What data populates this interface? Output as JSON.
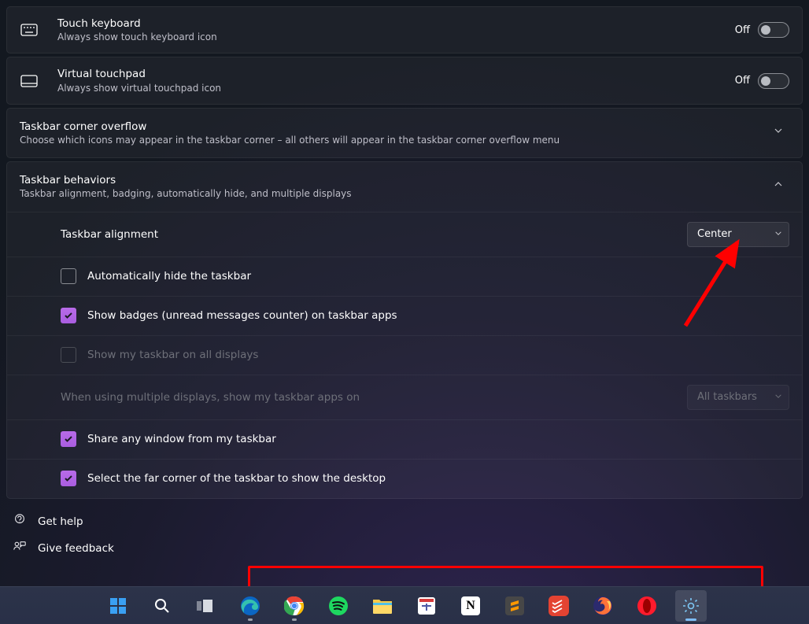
{
  "items": {
    "touch_keyboard": {
      "title": "Touch keyboard",
      "sub": "Always show touch keyboard icon",
      "state": "Off"
    },
    "virtual_touchpad": {
      "title": "Virtual touchpad",
      "sub": "Always show virtual touchpad icon",
      "state": "Off"
    }
  },
  "sections": {
    "overflow": {
      "title": "Taskbar corner overflow",
      "sub": "Choose which icons may appear in the taskbar corner – all others will appear in the taskbar corner overflow menu"
    },
    "behaviors": {
      "title": "Taskbar behaviors",
      "sub": "Taskbar alignment, badging, automatically hide, and multiple displays"
    }
  },
  "behaviors": {
    "alignment": {
      "label": "Taskbar alignment",
      "value": "Center"
    },
    "auto_hide": {
      "label": "Automatically hide the taskbar",
      "checked": false
    },
    "badges": {
      "label": "Show badges (unread messages counter) on taskbar apps",
      "checked": true
    },
    "all_displays": {
      "label": "Show my taskbar on all displays",
      "checked": false
    },
    "multi_label": "When using multiple displays, show my taskbar apps on",
    "multi_value": "All taskbars",
    "share_window": {
      "label": "Share any window from my taskbar",
      "checked": true
    },
    "far_corner": {
      "label": "Select the far corner of the taskbar to show the desktop",
      "checked": true
    }
  },
  "footer": {
    "help": "Get help",
    "feedback": "Give feedback"
  },
  "taskbar_apps": [
    {
      "name": "start",
      "running": false
    },
    {
      "name": "search",
      "running": false
    },
    {
      "name": "task-view",
      "running": false
    },
    {
      "name": "edge",
      "running": true
    },
    {
      "name": "chrome",
      "running": true
    },
    {
      "name": "spotify",
      "running": false
    },
    {
      "name": "file-explorer",
      "running": false
    },
    {
      "name": "snipping-tool",
      "running": false
    },
    {
      "name": "notion",
      "running": false
    },
    {
      "name": "sublime",
      "running": false
    },
    {
      "name": "todoist",
      "running": false
    },
    {
      "name": "firefox",
      "running": false
    },
    {
      "name": "opera",
      "running": false
    },
    {
      "name": "settings",
      "running": true,
      "active": true
    }
  ]
}
